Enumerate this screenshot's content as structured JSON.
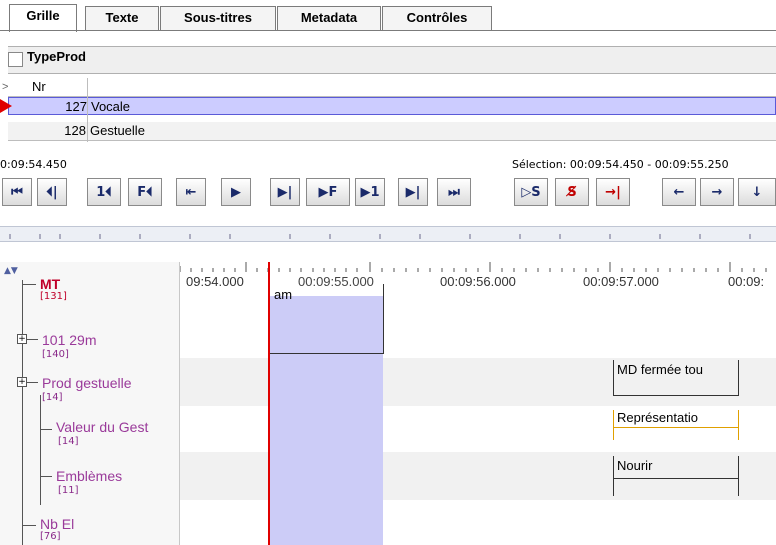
{
  "tabs": [
    "Grille",
    "Texte",
    "Sous-titres",
    "Metadata",
    "Contrôles"
  ],
  "grid": {
    "tier_name": "TypeProd",
    "header": {
      "marker": ">",
      "nr": "Nr"
    },
    "rows": [
      {
        "nr": "127",
        "value": "Vocale",
        "selected": true
      },
      {
        "nr": "128",
        "value": "Gestuelle",
        "selected": false
      }
    ]
  },
  "time": {
    "current": "0:09:54.450",
    "selection": "Sélection: 00:09:54.450 - 00:09:55.250"
  },
  "buttons": [
    "⏮",
    "⏴|",
    "1⏴",
    "F⏴",
    "⇤",
    "▶",
    "▶|",
    "▶F",
    "▶1",
    "▶|",
    "⏭",
    "▷S",
    "S̸",
    "→|",
    "←",
    "→",
    "↓"
  ],
  "ruler": {
    "labels": [
      "09:54.000",
      "00:09:55.000",
      "00:09:56.000",
      "00:09:57.000",
      "00:09:"
    ]
  },
  "tiers": [
    {
      "name": "MT",
      "count": "[131]",
      "color": "#c0002a"
    },
    {
      "name": "101 29m",
      "count": "[140]",
      "color": "#9a3a9a"
    },
    {
      "name": "Prod gestuelle",
      "count": "[14]",
      "color": "#9a3a9a"
    },
    {
      "name": "Valeur du Gest",
      "count": "[14]",
      "color": "#9a3a9a"
    },
    {
      "name": "Emblèmes",
      "count": "[11]",
      "color": "#9a3a9a"
    },
    {
      "name": "Nb El",
      "count": "[76]",
      "color": "#9a3a9a"
    }
  ],
  "annotations": {
    "am": "am",
    "md": "MD fermée tou",
    "rep": "Représentatio",
    "nourir": "Nourir"
  },
  "colors": {
    "selection": "#ccccf7",
    "cursor": "#e00000",
    "selected_row": "#ccccff"
  }
}
